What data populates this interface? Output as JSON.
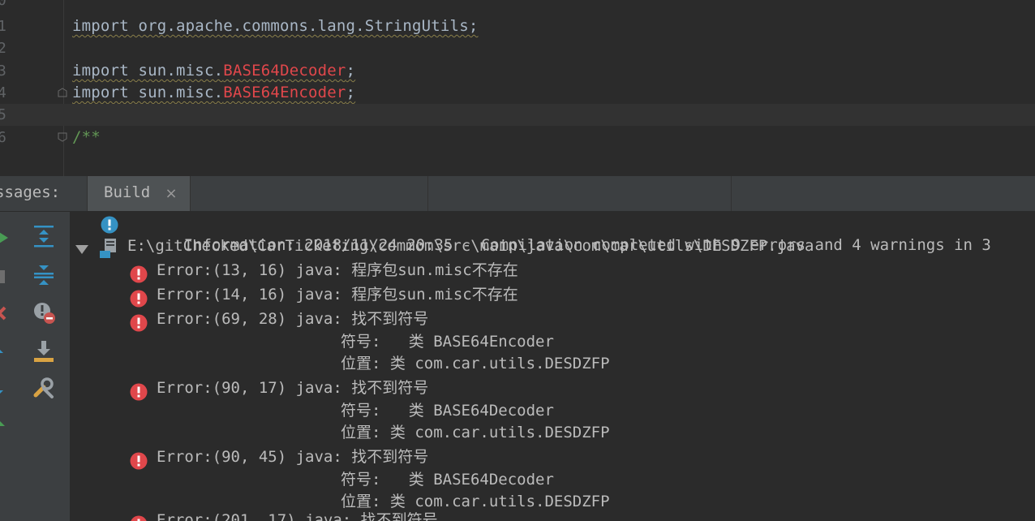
{
  "editor": {
    "lines": [
      {
        "num": "0",
        "text": ""
      },
      {
        "num": "1",
        "parts": [
          {
            "t": "import org.apache.commons.lang.StringUtils;",
            "c": "kw",
            "sq": true
          }
        ]
      },
      {
        "num": "2",
        "text": ""
      },
      {
        "num": "3",
        "parts": [
          {
            "t": "import sun.misc.",
            "c": "kw",
            "sq": true
          },
          {
            "t": "BASE64Decoder",
            "c": "err-id",
            "sq": true
          },
          {
            "t": ";",
            "c": "kw",
            "sq": true
          }
        ]
      },
      {
        "num": "4",
        "parts": [
          {
            "t": "import sun.misc.",
            "c": "kw",
            "sq": true
          },
          {
            "t": "BASE64Encoder",
            "c": "err-id",
            "sq": true
          },
          {
            "t": ";",
            "c": "kw",
            "sq": true
          }
        ]
      },
      {
        "num": "5",
        "text": ""
      },
      {
        "num": "6",
        "parts": [
          {
            "t": "/**",
            "c": "comment",
            "sq": false
          }
        ]
      }
    ]
  },
  "tabbar": {
    "label": "ssages:",
    "active_tab": "Build",
    "close_glyph": "×"
  },
  "messages": {
    "info": {
      "label": "Information:",
      "text": "2018/11/24 20:35 - Compilation completed with 9 errors and 4 warnings in 3"
    },
    "file": {
      "path": "E:\\gitChecked\\CarTicketing\\commom\\src\\main\\java\\com\\car\\utils\\DESDZFP.java"
    },
    "errors": [
      {
        "pos": "Error:(13, 16)",
        "msg": "java: 程序包sun.misc不存在",
        "details": []
      },
      {
        "pos": "Error:(14, 16)",
        "msg": "java: 程序包sun.misc不存在",
        "details": []
      },
      {
        "pos": "Error:(69, 28)",
        "msg": "java: 找不到符号",
        "details": [
          "符号:   类 BASE64Encoder",
          "位置: 类 com.car.utils.DESDZFP"
        ]
      },
      {
        "pos": "Error:(90, 17)",
        "msg": "java: 找不到符号",
        "details": [
          "符号:   类 BASE64Decoder",
          "位置: 类 com.car.utils.DESDZFP"
        ]
      },
      {
        "pos": "Error:(90, 45)",
        "msg": "java: 找不到符号",
        "details": [
          "符号:   类 BASE64Decoder",
          "位置: 类 com.car.utils.DESDZFP"
        ]
      },
      {
        "pos": "Error:(201, 17)",
        "msg": "java: 找不到符号",
        "details": []
      }
    ]
  },
  "toolbar": {
    "icons": [
      "rerun-icon",
      "stop-icon",
      "close-icon",
      "expand-all-icon",
      "collapse-all-icon",
      "hide-warnings-icon",
      "export-icon",
      "settings-wrench-icon",
      "previous-icon",
      "next-icon",
      "help-icon"
    ]
  },
  "colors": {
    "editor_bg": "#2b2b2b",
    "panel_bg": "#3c3f41",
    "text": "#bbbbbb",
    "error_red": "#e0474b",
    "info_blue": "#3592c4",
    "comment_green": "#629755"
  }
}
